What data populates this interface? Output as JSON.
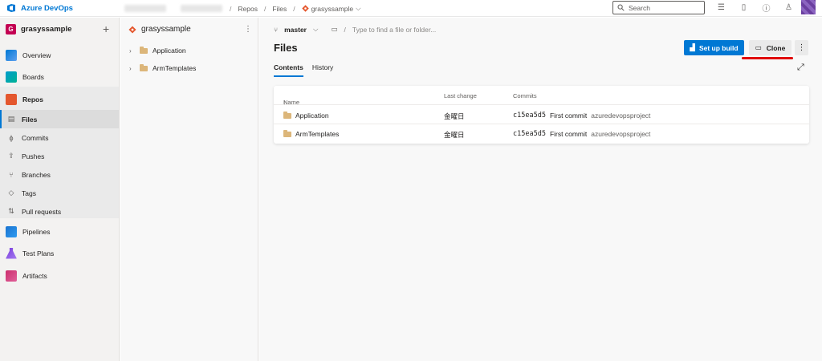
{
  "app": {
    "name": "Azure DevOps"
  },
  "breadcrumb": {
    "repos": "Repos",
    "files": "Files",
    "repo": "grasyssample"
  },
  "search": {
    "placeholder": "Search"
  },
  "project": {
    "initial": "G",
    "name": "grasyssample"
  },
  "nav": {
    "overview": "Overview",
    "boards": "Boards",
    "repos": "Repos",
    "files": "Files",
    "commits": "Commits",
    "pushes": "Pushes",
    "branches": "Branches",
    "tags": "Tags",
    "pull_requests": "Pull requests",
    "pipelines": "Pipelines",
    "test_plans": "Test Plans",
    "artifacts": "Artifacts"
  },
  "tree": {
    "repo": "grasyssample",
    "items": [
      {
        "label": "Application"
      },
      {
        "label": "ArmTemplates"
      }
    ]
  },
  "main": {
    "branch": "master",
    "path_placeholder": "Type to find a file or folder...",
    "title": "Files",
    "setup_build": "Set up build",
    "clone": "Clone",
    "tabs": [
      {
        "label": "Contents"
      },
      {
        "label": "History"
      }
    ],
    "columns": {
      "name": "Name",
      "last_change": "Last change",
      "commits": "Commits"
    },
    "rows": [
      {
        "name": "Application",
        "last_change": "金曜日",
        "hash": "c15ea5d5",
        "message": "First commit",
        "author": "azuredevopsproject"
      },
      {
        "name": "ArmTemplates",
        "last_change": "金曜日",
        "hash": "c15ea5d5",
        "message": "First commit",
        "author": "azuredevopsproject"
      }
    ]
  },
  "colors": {
    "accent": "#0078d4",
    "project_badge": "#c30052",
    "annotation": "#e00000"
  },
  "icons": {
    "logo": "azure-devops-logo-icon",
    "repo": "git-repo-icon",
    "folder": "folder-icon",
    "branch": "branch-icon"
  }
}
